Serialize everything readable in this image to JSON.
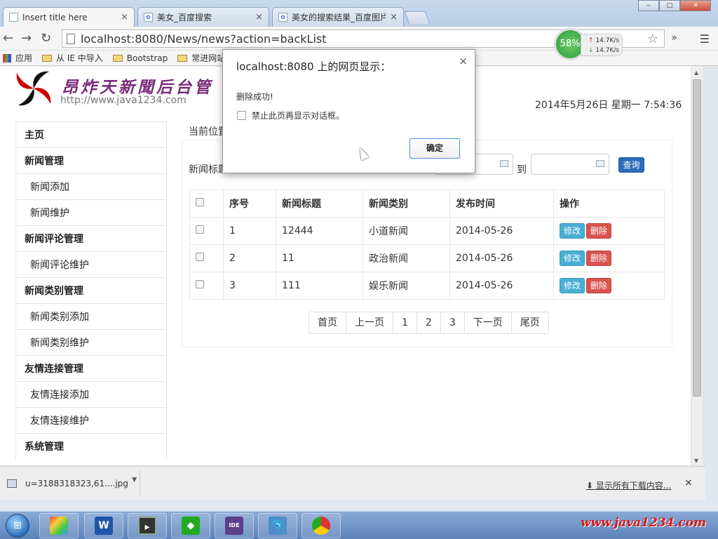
{
  "browser": {
    "tabs": [
      {
        "title": "Insert title here"
      },
      {
        "title": "美女_百度搜索"
      },
      {
        "title": "美女的搜索结果_百度图片"
      }
    ],
    "url": "localhost:8080/News/news?action=backList",
    "speed": {
      "percent": "58%",
      "up": "14.7K/s",
      "down": "14.7K/s"
    },
    "bookmarks": [
      "应用",
      "从 IE 中导入",
      "Bootstrap",
      "常进网站"
    ]
  },
  "page": {
    "site_title": "昂炸天新聞后台管",
    "site_url": "http://www.java1234.com",
    "datetime": "2014年5月26日 星期一 7:54:36",
    "sidebar": [
      {
        "label": "主页",
        "type": "head"
      },
      {
        "label": "新闻管理",
        "type": "head"
      },
      {
        "label": "新闻添加",
        "type": "sub"
      },
      {
        "label": "新闻维护",
        "type": "sub"
      },
      {
        "label": "新闻评论管理",
        "type": "head"
      },
      {
        "label": "新闻评论维护",
        "type": "sub"
      },
      {
        "label": "新闻类别管理",
        "type": "head"
      },
      {
        "label": "新闻类别添加",
        "type": "sub"
      },
      {
        "label": "新闻类别维护",
        "type": "sub"
      },
      {
        "label": "友情连接管理",
        "type": "head"
      },
      {
        "label": "友情连接添加",
        "type": "sub"
      },
      {
        "label": "友情连接维护",
        "type": "sub"
      },
      {
        "label": "系统管理",
        "type": "head"
      }
    ],
    "breadcrumb": "当前位置",
    "search": {
      "label": "新闻标题",
      "to_label": "到",
      "button": "查询"
    },
    "table": {
      "headers": [
        "序号",
        "新闻标题",
        "新闻类别",
        "发布时间",
        "操作"
      ],
      "rows": [
        {
          "no": "1",
          "title": "12444",
          "type": "小道新闻",
          "date": "2014-05-26"
        },
        {
          "no": "2",
          "title": "11",
          "type": "政治新闻",
          "date": "2014-05-26"
        },
        {
          "no": "3",
          "title": "111",
          "type": "娱乐新闻",
          "date": "2014-05-26"
        }
      ],
      "edit_label": "修改",
      "delete_label": "删除"
    },
    "pager": [
      "首页",
      "上一页",
      "1",
      "2",
      "3",
      "下一页",
      "尾页"
    ]
  },
  "dialog": {
    "title": "localhost:8080 上的网页显示：",
    "message": "删除成功!",
    "checkbox_label": "禁止此页再显示对话框。",
    "ok_label": "确定"
  },
  "downloads": {
    "file": "u=3188318323,61....jpg",
    "show_all": "显示所有下载内容..."
  },
  "watermark": "www.java1234.com",
  "colors": {
    "edit": "#49aed3",
    "delete": "#d9534f",
    "query": "#2a6ebb",
    "title": "#7a2d7c"
  }
}
